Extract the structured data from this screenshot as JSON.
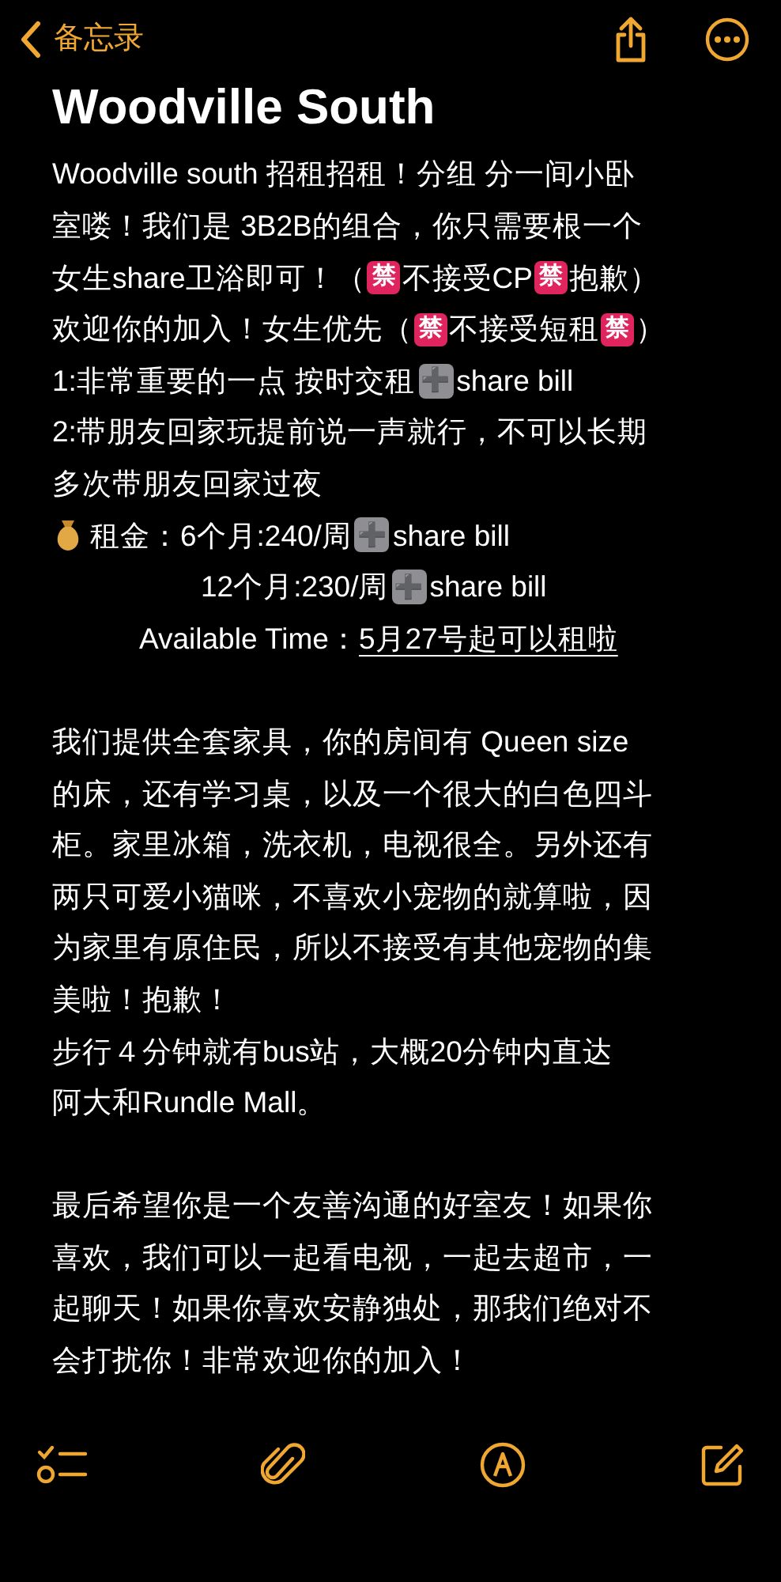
{
  "nav": {
    "back_label": "备忘录"
  },
  "note": {
    "title": "Woodville South",
    "lines": [
      {
        "kind": "plain",
        "segments": [
          {
            "kind": "text",
            "text": "Woodville south 招租招租！分组 分一间小卧"
          }
        ]
      },
      {
        "kind": "plain",
        "segments": [
          {
            "kind": "text",
            "text": "室喽！我们是 3B2B的组合，你只需要根一个"
          }
        ]
      },
      {
        "kind": "plain",
        "segments": [
          {
            "kind": "text",
            "text": "女生share卫浴即可！（"
          },
          {
            "kind": "badge",
            "text": "禁"
          },
          {
            "kind": "text",
            "text": "不接受CP"
          },
          {
            "kind": "badge",
            "text": "禁"
          },
          {
            "kind": "text",
            "text": "抱歉）"
          }
        ]
      },
      {
        "kind": "plain",
        "segments": [
          {
            "kind": "text",
            "text": "欢迎你的加入！女生优先（"
          },
          {
            "kind": "badge",
            "text": "禁"
          },
          {
            "kind": "text",
            "text": "不接受短租"
          },
          {
            "kind": "badge",
            "text": "禁"
          },
          {
            "kind": "text",
            "text": "）"
          }
        ]
      },
      {
        "kind": "plain",
        "segments": [
          {
            "kind": "text",
            "text": "1:非常重要的一点 按时交租"
          },
          {
            "kind": "plus",
            "text": "➕"
          },
          {
            "kind": "text",
            "text": "share bill"
          }
        ]
      },
      {
        "kind": "plain",
        "segments": [
          {
            "kind": "text",
            "text": "2:带朋友回家玩提前说一声就行，不可以长期"
          }
        ]
      },
      {
        "kind": "plain",
        "segments": [
          {
            "kind": "text",
            "text": "多次带朋友回家过夜"
          }
        ]
      },
      {
        "kind": "money",
        "segments": [
          {
            "kind": "text",
            "text": "租金：6个月:240/周"
          },
          {
            "kind": "plus",
            "text": "➕"
          },
          {
            "kind": "text",
            "text": "share bill"
          }
        ]
      },
      {
        "kind": "wide_indent",
        "segments": [
          {
            "kind": "text",
            "text": "12个月:230/周"
          },
          {
            "kind": "plus",
            "text": "➕"
          },
          {
            "kind": "text",
            "text": "share bill"
          }
        ]
      },
      {
        "kind": "indent",
        "segments": [
          {
            "kind": "text",
            "text": "Available Time："
          },
          {
            "kind": "underlined",
            "text": "5月27号起可以租啦"
          }
        ]
      },
      {
        "kind": "blank"
      },
      {
        "kind": "plain",
        "segments": [
          {
            "kind": "text",
            "text": "我们提供全套家具，你的房间有 Queen size"
          }
        ]
      },
      {
        "kind": "plain",
        "segments": [
          {
            "kind": "text",
            "text": "的床，还有学习桌，以及一个很大的白色四斗"
          }
        ]
      },
      {
        "kind": "plain",
        "segments": [
          {
            "kind": "text",
            "text": "柜。家里冰箱，洗衣机，电视很全。另外还有"
          }
        ]
      },
      {
        "kind": "plain",
        "segments": [
          {
            "kind": "text",
            "text": "两只可爱小猫咪，不喜欢小宠物的就算啦，因"
          }
        ]
      },
      {
        "kind": "plain",
        "segments": [
          {
            "kind": "text",
            "text": "为家里有原住民，所以不接受有其他宠物的集"
          }
        ]
      },
      {
        "kind": "plain",
        "segments": [
          {
            "kind": "text",
            "text": "美啦！抱歉！"
          }
        ]
      },
      {
        "kind": "plain",
        "segments": [
          {
            "kind": "text",
            "text": "步行４分钟就有bus站，大概20分钟内直达"
          }
        ]
      },
      {
        "kind": "plain",
        "segments": [
          {
            "kind": "text",
            "text": "阿大和Rundle Mall。"
          }
        ]
      },
      {
        "kind": "blank"
      },
      {
        "kind": "plain",
        "segments": [
          {
            "kind": "text",
            "text": "最后希望你是一个友善沟通的好室友！如果你"
          }
        ]
      },
      {
        "kind": "plain",
        "segments": [
          {
            "kind": "text",
            "text": "喜欢，我们可以一起看电视，一起去超市，一"
          }
        ]
      },
      {
        "kind": "plain",
        "segments": [
          {
            "kind": "text",
            "text": "起聊天！如果你喜欢安静独处，那我们绝对不"
          }
        ]
      },
      {
        "kind": "plain",
        "segments": [
          {
            "kind": "text",
            "text": "会打扰你！非常欢迎你的加入！"
          }
        ]
      }
    ]
  }
}
